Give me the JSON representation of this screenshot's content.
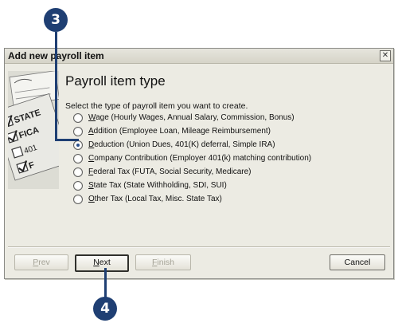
{
  "callouts": {
    "top": "3",
    "bottom": "4"
  },
  "dialog": {
    "title": "Add new payroll item",
    "close_glyph": "✕",
    "heading": "Payroll item type",
    "instruction": "Select the type of payroll item you want to create.",
    "illustration_labels": {
      "state": "STATE",
      "fica": "FICA",
      "k401": "401",
      "fed": "F"
    },
    "options": [
      {
        "mnemonic": "W",
        "rest": "age (Hourly Wages, Annual Salary, Commission, Bonus)",
        "selected": false
      },
      {
        "mnemonic": "A",
        "rest": "ddition (Employee Loan, Mileage Reimbursement)",
        "selected": false
      },
      {
        "mnemonic": "D",
        "rest": "eduction (Union Dues, 401(K) deferral, Simple IRA)",
        "selected": true
      },
      {
        "mnemonic": "C",
        "rest": "ompany Contribution (Employer 401(k) matching contribution)",
        "selected": false
      },
      {
        "mnemonic": "F",
        "rest": "ederal Tax (FUTA, Social Security, Medicare)",
        "selected": false
      },
      {
        "mnemonic": "S",
        "rest": "tate Tax (State Withholding, SDI, SUI)",
        "selected": false
      },
      {
        "mnemonic": "O",
        "rest": "ther Tax (Local Tax, Misc. State Tax)",
        "selected": false
      }
    ],
    "buttons": {
      "prev": {
        "mnemonic": "P",
        "rest": "rev"
      },
      "next": {
        "mnemonic": "N",
        "rest": "ext"
      },
      "finish": {
        "mnemonic": "F",
        "rest": "inish"
      },
      "cancel": "Cancel"
    }
  },
  "colors": {
    "callout": "#1f3f73",
    "dialog_bg": "#ecebe3"
  }
}
